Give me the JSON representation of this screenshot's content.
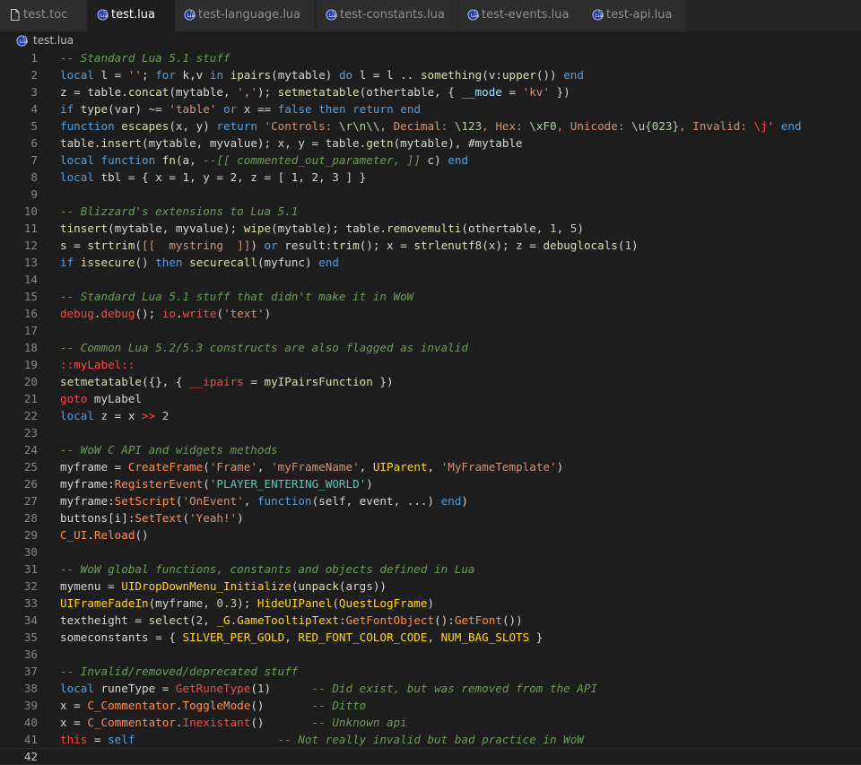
{
  "tabs": [
    {
      "label": "test.toc",
      "icon": "file-icon",
      "active": false
    },
    {
      "label": "test.lua",
      "icon": "lua-file-icon",
      "active": true
    },
    {
      "label": "test-language.lua",
      "icon": "lua-file-icon",
      "active": false
    },
    {
      "label": "test-constants.lua",
      "icon": "lua-file-icon",
      "active": false
    },
    {
      "label": "test-events.lua",
      "icon": "lua-file-icon",
      "active": false
    },
    {
      "label": "test-api.lua",
      "icon": "lua-file-icon",
      "active": false
    }
  ],
  "breadcrumb": {
    "label": "test.lua",
    "icon": "lua-file-icon"
  },
  "colors": {
    "text": "#d4d4d4",
    "comment": "#6a9955",
    "keyword": "#569cd6",
    "keyword_pink": "#c586c0",
    "string": "#ce9178",
    "number": "#b5cea8",
    "function": "#dcdcaa",
    "variable": "#9cdcfe",
    "invalid": "#f44747",
    "wow_api": "#ff8c42",
    "wow_global": "#ffd700",
    "wow_constant": "#4ec9b0"
  },
  "current_line": 42,
  "lines": [
    [
      [
        "-- Standard Lua 5.1 stuff",
        "comment"
      ]
    ],
    [
      [
        "local",
        "keyword"
      ],
      [
        " l = ",
        "text"
      ],
      [
        "''",
        "string"
      ],
      [
        "; ",
        "text"
      ],
      [
        "for",
        "keyword"
      ],
      [
        " k,v ",
        "text"
      ],
      [
        "in",
        "keyword"
      ],
      [
        " ",
        "text"
      ],
      [
        "ipairs",
        "function"
      ],
      [
        "(mytable) ",
        "text"
      ],
      [
        "do",
        "keyword"
      ],
      [
        " l = l .. ",
        "text"
      ],
      [
        "something",
        "function"
      ],
      [
        "(v:",
        "text"
      ],
      [
        "upper",
        "function"
      ],
      [
        "()) ",
        "text"
      ],
      [
        "end",
        "keyword"
      ]
    ],
    [
      [
        "z = table.",
        "text"
      ],
      [
        "concat",
        "function"
      ],
      [
        "(mytable, ",
        "text"
      ],
      [
        "','",
        "string"
      ],
      [
        "); ",
        "text"
      ],
      [
        "setmetatable",
        "function"
      ],
      [
        "(othertable, { ",
        "text"
      ],
      [
        "__mode",
        "variable"
      ],
      [
        " = ",
        "text"
      ],
      [
        "'kv'",
        "string"
      ],
      [
        " })",
        "text"
      ]
    ],
    [
      [
        "if",
        "keyword"
      ],
      [
        " ",
        "text"
      ],
      [
        "type",
        "function"
      ],
      [
        "(var) ~= ",
        "text"
      ],
      [
        "'table'",
        "string"
      ],
      [
        " ",
        "text"
      ],
      [
        "or",
        "keyword"
      ],
      [
        " x == ",
        "text"
      ],
      [
        "false",
        "keyword"
      ],
      [
        " ",
        "text"
      ],
      [
        "then",
        "keyword"
      ],
      [
        " ",
        "text"
      ],
      [
        "return",
        "keyword"
      ],
      [
        " ",
        "text"
      ],
      [
        "end",
        "keyword"
      ]
    ],
    [
      [
        "function",
        "keyword"
      ],
      [
        " ",
        "text"
      ],
      [
        "escapes",
        "function"
      ],
      [
        "(x, y) ",
        "text"
      ],
      [
        "return",
        "keyword"
      ],
      [
        " ",
        "text"
      ],
      [
        "'Controls: ",
        "string"
      ],
      [
        "\\r\\n\\\\",
        "number"
      ],
      [
        ", Decimal: ",
        "string"
      ],
      [
        "\\123",
        "number"
      ],
      [
        ", Hex: ",
        "string"
      ],
      [
        "\\xF0",
        "number"
      ],
      [
        ", Unicode: ",
        "string"
      ],
      [
        "\\u{023}",
        "number"
      ],
      [
        ", Invalid: ",
        "string"
      ],
      [
        "\\j",
        "invalid"
      ],
      [
        "'",
        "string"
      ],
      [
        " ",
        "text"
      ],
      [
        "end",
        "keyword"
      ]
    ],
    [
      [
        "table.",
        "text"
      ],
      [
        "insert",
        "function"
      ],
      [
        "(mytable, myvalue); x, y = table.",
        "text"
      ],
      [
        "getn",
        "function"
      ],
      [
        "(mytable), #mytable",
        "text"
      ]
    ],
    [
      [
        "local",
        "keyword"
      ],
      [
        " ",
        "text"
      ],
      [
        "function",
        "keyword"
      ],
      [
        " ",
        "text"
      ],
      [
        "fn",
        "function"
      ],
      [
        "(a, ",
        "text"
      ],
      [
        "--[[ commented_out_parameter, ]]",
        "comment"
      ],
      [
        " c) ",
        "text"
      ],
      [
        "end",
        "keyword"
      ]
    ],
    [
      [
        "local",
        "keyword"
      ],
      [
        " tbl = { x = 1, y = 2, z = [ 1, 2, 3 ] }",
        "text"
      ]
    ],
    [],
    [
      [
        "-- Blizzard's extensions to Lua 5.1",
        "comment"
      ]
    ],
    [
      [
        "tinsert",
        "function"
      ],
      [
        "(mytable, myvalue); ",
        "text"
      ],
      [
        "wipe",
        "function"
      ],
      [
        "(mytable); table.",
        "text"
      ],
      [
        "removemulti",
        "function"
      ],
      [
        "(othertable, ",
        "text"
      ],
      [
        "1",
        "number"
      ],
      [
        ", ",
        "text"
      ],
      [
        "5",
        "number"
      ],
      [
        ")",
        "text"
      ]
    ],
    [
      [
        "s = ",
        "text"
      ],
      [
        "strtrim",
        "function"
      ],
      [
        "(",
        "text"
      ],
      [
        "[[  mystring  ]]",
        "string"
      ],
      [
        ") ",
        "text"
      ],
      [
        "or",
        "keyword"
      ],
      [
        " result:",
        "text"
      ],
      [
        "trim",
        "function"
      ],
      [
        "(); x = ",
        "text"
      ],
      [
        "strlenutf8",
        "function"
      ],
      [
        "(x); z = ",
        "text"
      ],
      [
        "debuglocals",
        "function"
      ],
      [
        "(",
        "text"
      ],
      [
        "1",
        "number"
      ],
      [
        ")",
        "text"
      ]
    ],
    [
      [
        "if",
        "keyword"
      ],
      [
        " ",
        "text"
      ],
      [
        "issecure",
        "function"
      ],
      [
        "() ",
        "text"
      ],
      [
        "then",
        "keyword"
      ],
      [
        " ",
        "text"
      ],
      [
        "securecall",
        "function"
      ],
      [
        "(myfunc) ",
        "text"
      ],
      [
        "end",
        "keyword"
      ]
    ],
    [],
    [
      [
        "-- Standard Lua 5.1 stuff that didn't make it in WoW",
        "comment"
      ]
    ],
    [
      [
        "debug",
        "invalid"
      ],
      [
        ".",
        "text"
      ],
      [
        "debug",
        "invalid"
      ],
      [
        "(); ",
        "text"
      ],
      [
        "io",
        "invalid"
      ],
      [
        ".",
        "text"
      ],
      [
        "write",
        "invalid"
      ],
      [
        "(",
        "text"
      ],
      [
        "'text'",
        "string"
      ],
      [
        ")",
        "text"
      ]
    ],
    [],
    [
      [
        "-- Common Lua 5.2/5.3 constructs are also flagged as invalid",
        "comment"
      ]
    ],
    [
      [
        "::myLabel::",
        "invalid"
      ]
    ],
    [
      [
        "setmetatable",
        "function"
      ],
      [
        "({}, { ",
        "text"
      ],
      [
        "__ipairs",
        "invalid"
      ],
      [
        " = ",
        "text"
      ],
      [
        "myIPairsFunction",
        "function"
      ],
      [
        " })",
        "text"
      ]
    ],
    [
      [
        "goto",
        "invalid"
      ],
      [
        " myLabel",
        "text"
      ]
    ],
    [
      [
        "local",
        "keyword"
      ],
      [
        " z = x ",
        "text"
      ],
      [
        ">>",
        "invalid"
      ],
      [
        " ",
        "text"
      ],
      [
        "2",
        "number"
      ]
    ],
    [],
    [
      [
        "-- WoW C API and widgets methods",
        "comment"
      ]
    ],
    [
      [
        "myframe = ",
        "text"
      ],
      [
        "CreateFrame",
        "wow_api"
      ],
      [
        "(",
        "text"
      ],
      [
        "'Frame'",
        "string"
      ],
      [
        ", ",
        "text"
      ],
      [
        "'myFrameName'",
        "string"
      ],
      [
        ", ",
        "text"
      ],
      [
        "UIParent",
        "wow_global"
      ],
      [
        ", ",
        "text"
      ],
      [
        "'MyFrameTemplate'",
        "string"
      ],
      [
        ")",
        "text"
      ]
    ],
    [
      [
        "myframe:",
        "text"
      ],
      [
        "RegisterEvent",
        "wow_api"
      ],
      [
        "(",
        "text"
      ],
      [
        "'PLAYER_ENTERING_WORLD'",
        "wow_constant"
      ],
      [
        ")",
        "text"
      ]
    ],
    [
      [
        "myframe:",
        "text"
      ],
      [
        "SetScript",
        "wow_api"
      ],
      [
        "(",
        "text"
      ],
      [
        "'OnEvent'",
        "string"
      ],
      [
        ", ",
        "text"
      ],
      [
        "function",
        "keyword"
      ],
      [
        "(self, event, ...) ",
        "text"
      ],
      [
        "end",
        "keyword"
      ],
      [
        ")",
        "text"
      ]
    ],
    [
      [
        "buttons[i]:",
        "text"
      ],
      [
        "SetText",
        "wow_api"
      ],
      [
        "(",
        "text"
      ],
      [
        "'Yeah!'",
        "string"
      ],
      [
        ")",
        "text"
      ]
    ],
    [
      [
        "C_UI",
        "wow_api"
      ],
      [
        ".",
        "text"
      ],
      [
        "Reload",
        "wow_api"
      ],
      [
        "()",
        "text"
      ]
    ],
    [],
    [
      [
        "-- WoW global functions, constants and objects defined in Lua",
        "comment"
      ]
    ],
    [
      [
        "mymenu = ",
        "text"
      ],
      [
        "UIDropDownMenu_Initialize",
        "wow_global"
      ],
      [
        "(",
        "text"
      ],
      [
        "unpack",
        "function"
      ],
      [
        "(args))",
        "text"
      ]
    ],
    [
      [
        "UIFrameFadeIn",
        "wow_global"
      ],
      [
        "(myframe, ",
        "text"
      ],
      [
        "0.3",
        "number"
      ],
      [
        "); ",
        "text"
      ],
      [
        "HideUIPanel",
        "wow_global"
      ],
      [
        "(",
        "text"
      ],
      [
        "QuestLogFrame",
        "wow_global"
      ],
      [
        ")",
        "text"
      ]
    ],
    [
      [
        "textheight = ",
        "text"
      ],
      [
        "select",
        "function"
      ],
      [
        "(",
        "text"
      ],
      [
        "2",
        "number"
      ],
      [
        ", ",
        "text"
      ],
      [
        "_G",
        "wow_global"
      ],
      [
        ".",
        "text"
      ],
      [
        "GameTooltipText",
        "wow_global"
      ],
      [
        ":",
        "text"
      ],
      [
        "GetFontObject",
        "wow_api"
      ],
      [
        "():",
        "text"
      ],
      [
        "GetFont",
        "wow_api"
      ],
      [
        "())",
        "text"
      ]
    ],
    [
      [
        "someconstants = { ",
        "text"
      ],
      [
        "SILVER_PER_GOLD",
        "wow_global"
      ],
      [
        ", ",
        "text"
      ],
      [
        "RED_FONT_COLOR_CODE",
        "wow_global"
      ],
      [
        ", ",
        "text"
      ],
      [
        "NUM_BAG_SLOTS",
        "wow_global"
      ],
      [
        " }",
        "text"
      ]
    ],
    [],
    [
      [
        "-- Invalid/removed/deprecated stuff",
        "comment"
      ]
    ],
    [
      [
        "local",
        "keyword"
      ],
      [
        " runeType = ",
        "text"
      ],
      [
        "GetRuneType",
        "invalid"
      ],
      [
        "(",
        "text"
      ],
      [
        "1",
        "number"
      ],
      [
        ")      ",
        "text"
      ],
      [
        "-- Did exist, but was removed from the API",
        "comment"
      ]
    ],
    [
      [
        "x = ",
        "text"
      ],
      [
        "C_Commentator",
        "wow_api"
      ],
      [
        ".",
        "text"
      ],
      [
        "ToggleMode",
        "wow_api"
      ],
      [
        "()       ",
        "text"
      ],
      [
        "-- Ditto",
        "comment"
      ]
    ],
    [
      [
        "x = ",
        "text"
      ],
      [
        "C_Commentator",
        "wow_api"
      ],
      [
        ".",
        "text"
      ],
      [
        "Inexistant",
        "invalid"
      ],
      [
        "()       ",
        "text"
      ],
      [
        "-- Unknown api",
        "comment"
      ]
    ],
    [
      [
        "this",
        "invalid"
      ],
      [
        " = ",
        "text"
      ],
      [
        "self",
        "keyword"
      ],
      [
        "                     ",
        "text"
      ],
      [
        "-- Not really invalid but bad practice in WoW",
        "comment"
      ]
    ],
    []
  ]
}
